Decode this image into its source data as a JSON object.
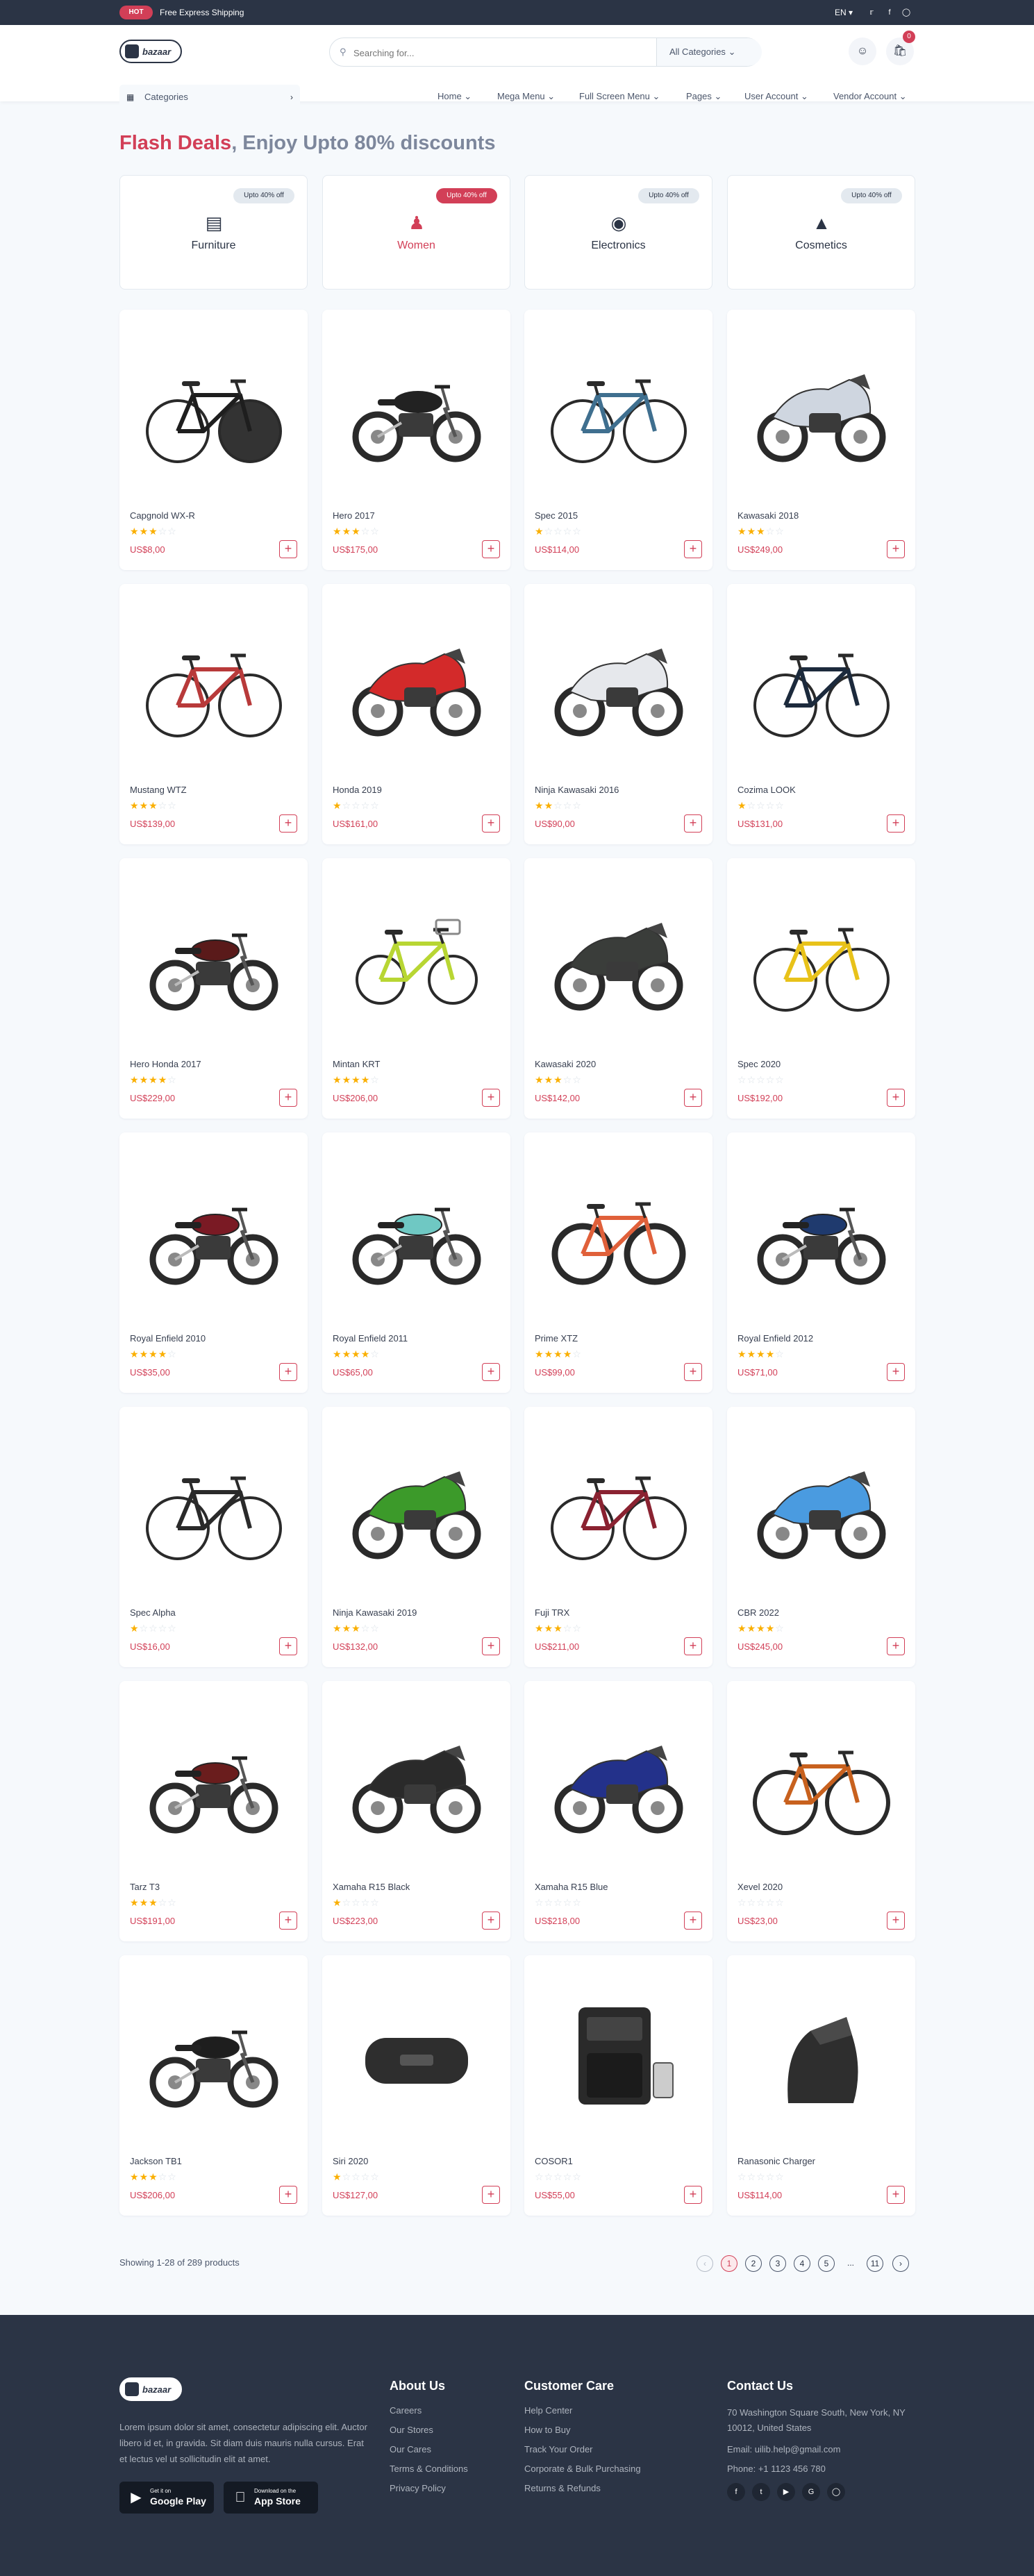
{
  "topbar": {
    "hot": "HOT",
    "shipping": "Free Express Shipping",
    "lang": "EN"
  },
  "header": {
    "logo": "bazaar",
    "search_placeholder": "Searching for...",
    "search_category": "All Categories",
    "cart_count": "0",
    "categories_label": "Categories",
    "nav": [
      "Home",
      "Mega Menu",
      "Full Screen Menu",
      "Pages",
      "User Account",
      "Vendor Account"
    ]
  },
  "flash": {
    "title_red": "Flash Deals",
    "title_rest": ", Enjoy Upto 80% discounts"
  },
  "categories": [
    {
      "label": "Furniture",
      "badge": "Upto 40% off",
      "icon": "sofa-icon"
    },
    {
      "label": "Women",
      "badge": "Upto 40% off",
      "icon": "dress-icon"
    },
    {
      "label": "Electronics",
      "badge": "Upto 40% off",
      "icon": "camera-icon"
    },
    {
      "label": "Cosmetics",
      "badge": "Upto 40% off",
      "icon": "perfume-icon"
    }
  ],
  "products": [
    {
      "name": "Capgnold WX-R",
      "rating": 3,
      "price": "US$8,00",
      "kind": "tt-bike"
    },
    {
      "name": "Hero 2017",
      "rating": 3,
      "price": "US$175,00",
      "kind": "motorbike",
      "color": "#222222"
    },
    {
      "name": "Spec 2015",
      "rating": 1,
      "price": "US$114,00",
      "kind": "bicycle",
      "color": "#3f6f8f"
    },
    {
      "name": "Kawasaki 2018",
      "rating": 3,
      "price": "US$249,00",
      "kind": "sportbike",
      "color": "#cfd6e0"
    },
    {
      "name": "Mustang WTZ",
      "rating": 3,
      "price": "US$139,00",
      "kind": "bicycle",
      "color": "#b83a3a"
    },
    {
      "name": "Honda 2019",
      "rating": 1,
      "price": "US$161,00",
      "kind": "sportbike",
      "color": "#d32a2a"
    },
    {
      "name": "Ninja Kawasaki 2016",
      "rating": 2,
      "price": "US$90,00",
      "kind": "sportbike",
      "color": "#e6e8ec"
    },
    {
      "name": "Cozima LOOK",
      "rating": 1,
      "price": "US$131,00",
      "kind": "bicycle",
      "color": "#1c2a3c"
    },
    {
      "name": "Hero Honda 2017",
      "rating": 4,
      "price": "US$229,00",
      "kind": "motorbike",
      "color": "#5a1a1a"
    },
    {
      "name": "Mintan KRT",
      "rating": 4,
      "price": "US$206,00",
      "kind": "kids-bike",
      "color": "#b8d633"
    },
    {
      "name": "Kawasaki 2020",
      "rating": 3,
      "price": "US$142,00",
      "kind": "sportbike",
      "color": "#3a3d3a"
    },
    {
      "name": "Spec 2020",
      "rating": 0,
      "price": "US$192,00",
      "kind": "bicycle",
      "color": "#e8c21a"
    },
    {
      "name": "Royal Enfield 2010",
      "rating": 4,
      "price": "US$35,00",
      "kind": "motorbike",
      "color": "#7a1a24"
    },
    {
      "name": "Royal Enfield 2011",
      "rating": 4,
      "price": "US$65,00",
      "kind": "motorbike",
      "color": "#6fc8c3"
    },
    {
      "name": "Prime XTZ",
      "rating": 4,
      "price": "US$99,00",
      "kind": "fat-bike",
      "color": "#e0603a"
    },
    {
      "name": "Royal Enfield 2012",
      "rating": 4,
      "price": "US$71,00",
      "kind": "motorbike",
      "color": "#1f3a6e"
    },
    {
      "name": "Spec Alpha",
      "rating": 1,
      "price": "US$16,00",
      "kind": "bicycle",
      "color": "#2a2a2a"
    },
    {
      "name": "Ninja Kawasaki 2019",
      "rating": 3,
      "price": "US$132,00",
      "kind": "sportbike",
      "color": "#3c9a2a"
    },
    {
      "name": "Fuji TRX",
      "rating": 3,
      "price": "US$211,00",
      "kind": "bicycle",
      "color": "#8a2231"
    },
    {
      "name": "CBR 2022",
      "rating": 4,
      "price": "US$245,00",
      "kind": "sportbike",
      "color": "#4a9be0"
    },
    {
      "name": "Tarz T3",
      "rating": 3,
      "price": "US$191,00",
      "kind": "motorbike",
      "color": "#6a1d1d"
    },
    {
      "name": "Xamaha R15 Black",
      "rating": 1,
      "price": "US$223,00",
      "kind": "sportbike",
      "color": "#2a2a2a"
    },
    {
      "name": "Xamaha R15 Blue",
      "rating": 0,
      "price": "US$218,00",
      "kind": "sportbike",
      "color": "#23318a"
    },
    {
      "name": "Xevel 2020",
      "rating": 0,
      "price": "US$23,00",
      "kind": "mtb",
      "color": "#c8611e"
    },
    {
      "name": "Jackson TB1",
      "rating": 3,
      "price": "US$206,00",
      "kind": "motorbike",
      "color": "#1e1e1e"
    },
    {
      "name": "Siri 2020",
      "rating": 1,
      "price": "US$127,00",
      "kind": "speaker",
      "color": "#2e2e2e"
    },
    {
      "name": "COSOR1",
      "rating": 0,
      "price": "US$55,00",
      "kind": "fryer",
      "color": "#2a2a2a"
    },
    {
      "name": "Ranasonic Charger",
      "rating": 0,
      "price": "US$114,00",
      "kind": "charger",
      "color": "#2e2e2e"
    }
  ],
  "pagination": {
    "showing": "Showing 1-28 of 289 products",
    "pages": [
      "1",
      "2",
      "3",
      "4",
      "5",
      "...",
      "11"
    ],
    "current": "1"
  },
  "footer": {
    "logo": "bazaar",
    "description": "Lorem ipsum dolor sit amet, consectetur adipiscing elit. Auctor libero id et, in gravida. Sit diam duis mauris nulla cursus. Erat et lectus vel ut sollicitudin elit at amet.",
    "google_small": "Get it on",
    "google_big": "Google Play",
    "apple_small": "Download on the",
    "apple_big": "App Store",
    "about_title": "About Us",
    "about_links": [
      "Careers",
      "Our Stores",
      "Our Cares",
      "Terms & Conditions",
      "Privacy Policy"
    ],
    "care_title": "Customer Care",
    "care_links": [
      "Help Center",
      "How to Buy",
      "Track Your Order",
      "Corporate & Bulk Purchasing",
      "Returns & Refunds"
    ],
    "contact_title": "Contact Us",
    "address": "70 Washington Square South, New York, NY 10012, United States",
    "email": "Email: uilib.help@gmail.com",
    "phone": "Phone: +1 1123 456 780"
  },
  "colors": {
    "primary": "#d23f57",
    "dark": "#2b3445",
    "star": "#faaf00"
  }
}
